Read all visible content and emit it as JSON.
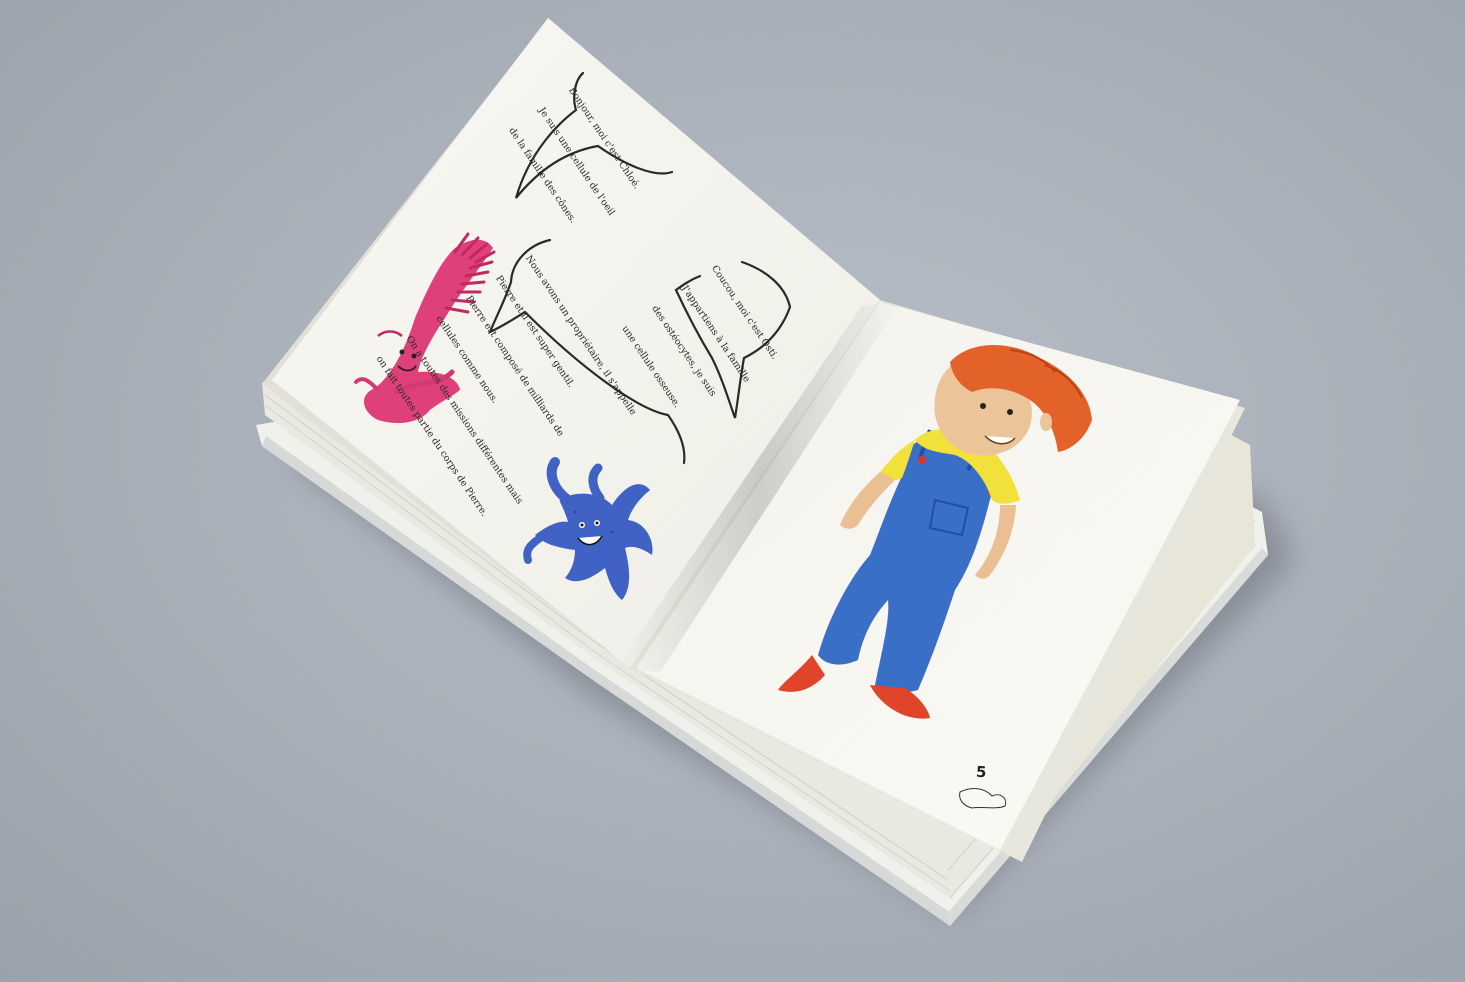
{
  "book": {
    "colors": {
      "background": "#a9afb8",
      "paper": "#f6f5ef",
      "cell_pink": "#e0407a",
      "cell_blue": "#3f62c4",
      "hair": "#e3622a",
      "shirt": "#f2e13a",
      "overalls": "#3a6fc8",
      "shoes": "#e0452b"
    },
    "left_page": {
      "bubbles": [
        {
          "speaker": "pink-cone-cell",
          "lines": [
            "Bonjour, moi c'est Chloé.",
            "Je suis une cellule de l'oeil",
            "de la famille des cônes."
          ]
        },
        {
          "speaker": "narrator",
          "lines": [
            "Nous avons un propriétaire, il s'appelle",
            "Pierre et il est super gentil.",
            "Pierre est composé de milliards de",
            "cellules comme nous.",
            "On a toutes des missions différentes mais",
            "on fait toutes partie du corps de Pierre."
          ]
        },
        {
          "speaker": "blue-bone-cell",
          "lines": [
            "Coucou, moi c'est Osti.",
            "J'appartiens à la famille",
            "des ostéocytes, je suis",
            "une cellule osseuse."
          ]
        }
      ]
    },
    "right_page": {
      "page_number": "5"
    }
  }
}
